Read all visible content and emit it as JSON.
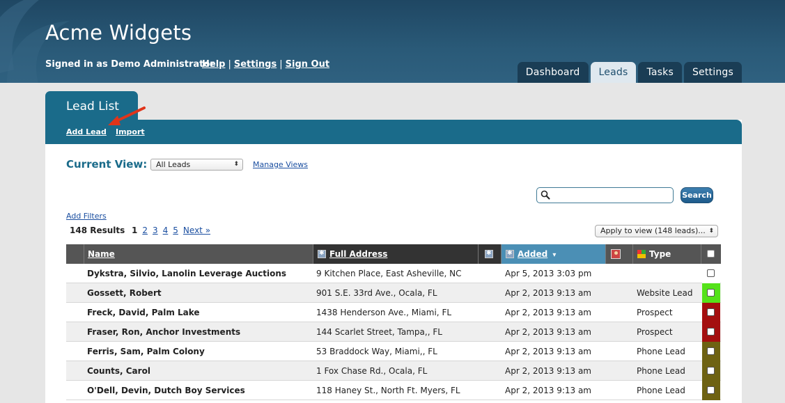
{
  "header": {
    "title": "Acme Widgets",
    "signed_in": "Signed in as Demo Administrator",
    "links": {
      "help": "Help",
      "settings": "Settings",
      "sign_out": "Sign Out",
      "separator": "|"
    },
    "tabs": [
      {
        "label": "Dashboard"
      },
      {
        "label": "Leads",
        "active": true
      },
      {
        "label": "Tasks"
      },
      {
        "label": "Settings"
      }
    ]
  },
  "panel": {
    "tab_label": "Lead List",
    "add_lead": "Add Lead",
    "import": "Import",
    "current_view_label": "Current View:",
    "view_select": "All Leads",
    "manage_views": "Manage Views",
    "search_placeholder": "",
    "search_button": "Search",
    "add_filters": "Add Filters",
    "results": "148 Results",
    "pager": {
      "current": "1",
      "pages": [
        "2",
        "3",
        "4",
        "5"
      ],
      "next": "Next »"
    },
    "apply_select": "Apply to view (148 leads)..."
  },
  "table": {
    "columns": {
      "name": "Name",
      "address": "Full Address",
      "added": "Added",
      "sort_indicator": "▾",
      "type": "Type"
    },
    "rows": [
      {
        "name": "Dykstra, Silvio, Lanolin Leverage Auctions",
        "address": "9 Kitchen Place, East Asheville, NC",
        "added": "Apr 5, 2013 3:03 pm",
        "type": "",
        "color": "#ffffff"
      },
      {
        "name": "Gossett, Robert",
        "address": "901 S.E. 33rd Ave., Ocala, FL",
        "added": "Apr 2, 2013 9:13 am",
        "type": "Website Lead",
        "color": "#55e21a"
      },
      {
        "name": "Freck, David, Palm Lake",
        "address": "1438 Henderson Ave., Miami, FL",
        "added": "Apr 2, 2013 9:13 am",
        "type": "Prospect",
        "color": "#a40f0f"
      },
      {
        "name": "Fraser, Ron, Anchor Investments",
        "address": "144 Scarlet Street, Tampa,, FL",
        "added": "Apr 2, 2013 9:13 am",
        "type": "Prospect",
        "color": "#a40f0f"
      },
      {
        "name": "Ferris, Sam, Palm Colony",
        "address": "53 Braddock Way, Miami,, FL",
        "added": "Apr 2, 2013 9:13 am",
        "type": "Phone Lead",
        "color": "#6e6212"
      },
      {
        "name": "Counts, Carol",
        "address": "1 Fox Chase Rd., Ocala, FL",
        "added": "Apr 2, 2013 9:13 am",
        "type": "Phone Lead",
        "color": "#6e6212"
      },
      {
        "name": "O'Dell, Devin, Dutch Boy Services",
        "address": "118 Haney St., North Ft. Myers, FL",
        "added": "Apr 2, 2013 9:13 am",
        "type": "Phone Lead",
        "color": "#6e6212"
      }
    ]
  },
  "colors": {
    "header_bg": "#24506e",
    "accent": "#1a6b8a",
    "link": "#1a4ea0"
  }
}
